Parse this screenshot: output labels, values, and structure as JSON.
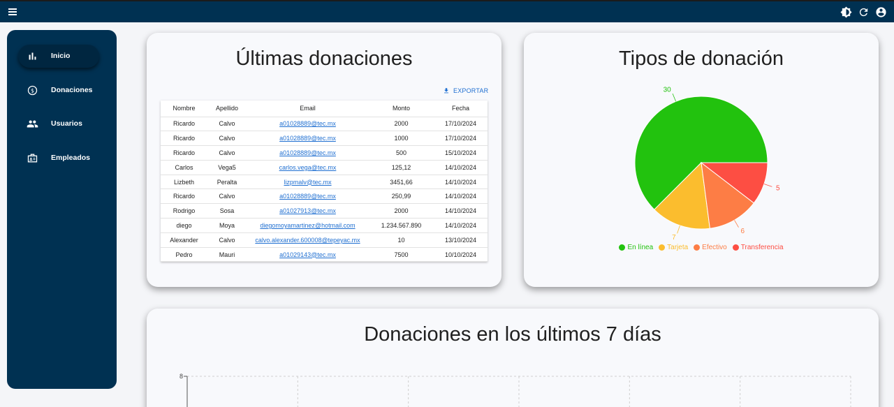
{
  "topbar": {
    "menu_icon": "hamburger-icon",
    "icons": [
      "theme-toggle-icon",
      "refresh-icon",
      "account-icon"
    ]
  },
  "sidebar": {
    "items": [
      {
        "label": "Inicio",
        "icon": "bar-chart-icon",
        "active": true
      },
      {
        "label": "Donaciones",
        "icon": "dollar-circle-icon",
        "active": false
      },
      {
        "label": "Usuarios",
        "icon": "people-icon",
        "active": false
      },
      {
        "label": "Empleados",
        "icon": "badge-icon",
        "active": false
      }
    ]
  },
  "donations": {
    "title": "Últimas donaciones",
    "export_label": "EXPORTAR",
    "columns": [
      "Nombre",
      "Apellido",
      "Email",
      "Monto",
      "Fecha"
    ],
    "rows": [
      [
        "Ricardo",
        "Calvo",
        "a01028889@tec.mx",
        "2000",
        "17/10/2024"
      ],
      [
        "Ricardo",
        "Calvo",
        "a01028889@tec.mx",
        "1000",
        "17/10/2024"
      ],
      [
        "Ricardo",
        "Calvo",
        "a01028889@tec.mx",
        "500",
        "15/10/2024"
      ],
      [
        "Carlos",
        "Vega5",
        "carlos.vega@tec.mx",
        "125,12",
        "14/10/2024"
      ],
      [
        "Lizbeth",
        "Peralta",
        "lizpmalv@tec.mx",
        "3451,66",
        "14/10/2024"
      ],
      [
        "Ricardo",
        "Calvo",
        "a01028889@tec.mx",
        "250,99",
        "14/10/2024"
      ],
      [
        "Rodrigo",
        "Sosa",
        "a01027913@tec.mx",
        "2000",
        "14/10/2024"
      ],
      [
        "diego",
        "Moya",
        "diegomoyamartinez@hotmail.com",
        "1.234.567.890",
        "14/10/2024"
      ],
      [
        "Alexander",
        "Calvo",
        "calvo.alexander.600008@tepeyac.mx",
        "10",
        "13/10/2024"
      ],
      [
        "Pedro",
        "Mauri",
        "a01029143@tec.mx",
        "7500",
        "10/10/2024"
      ]
    ]
  },
  "types": {
    "title": "Tipos de donación",
    "chart_data": {
      "type": "pie",
      "categories": [
        "En línea",
        "Tarjeta",
        "Efectivo",
        "Transferencia"
      ],
      "values": [
        30,
        7,
        6,
        5
      ],
      "colors": [
        "#22c20e",
        "#fbbd2e",
        "#fd7d45",
        "#fd4e43"
      ],
      "legend": "bottom"
    }
  },
  "week": {
    "title": "Donaciones en los últimos 7 días",
    "chart_data": {
      "type": "line",
      "y_ticks": [
        "8"
      ],
      "ylim": [
        0,
        8
      ],
      "grid": true
    }
  }
}
